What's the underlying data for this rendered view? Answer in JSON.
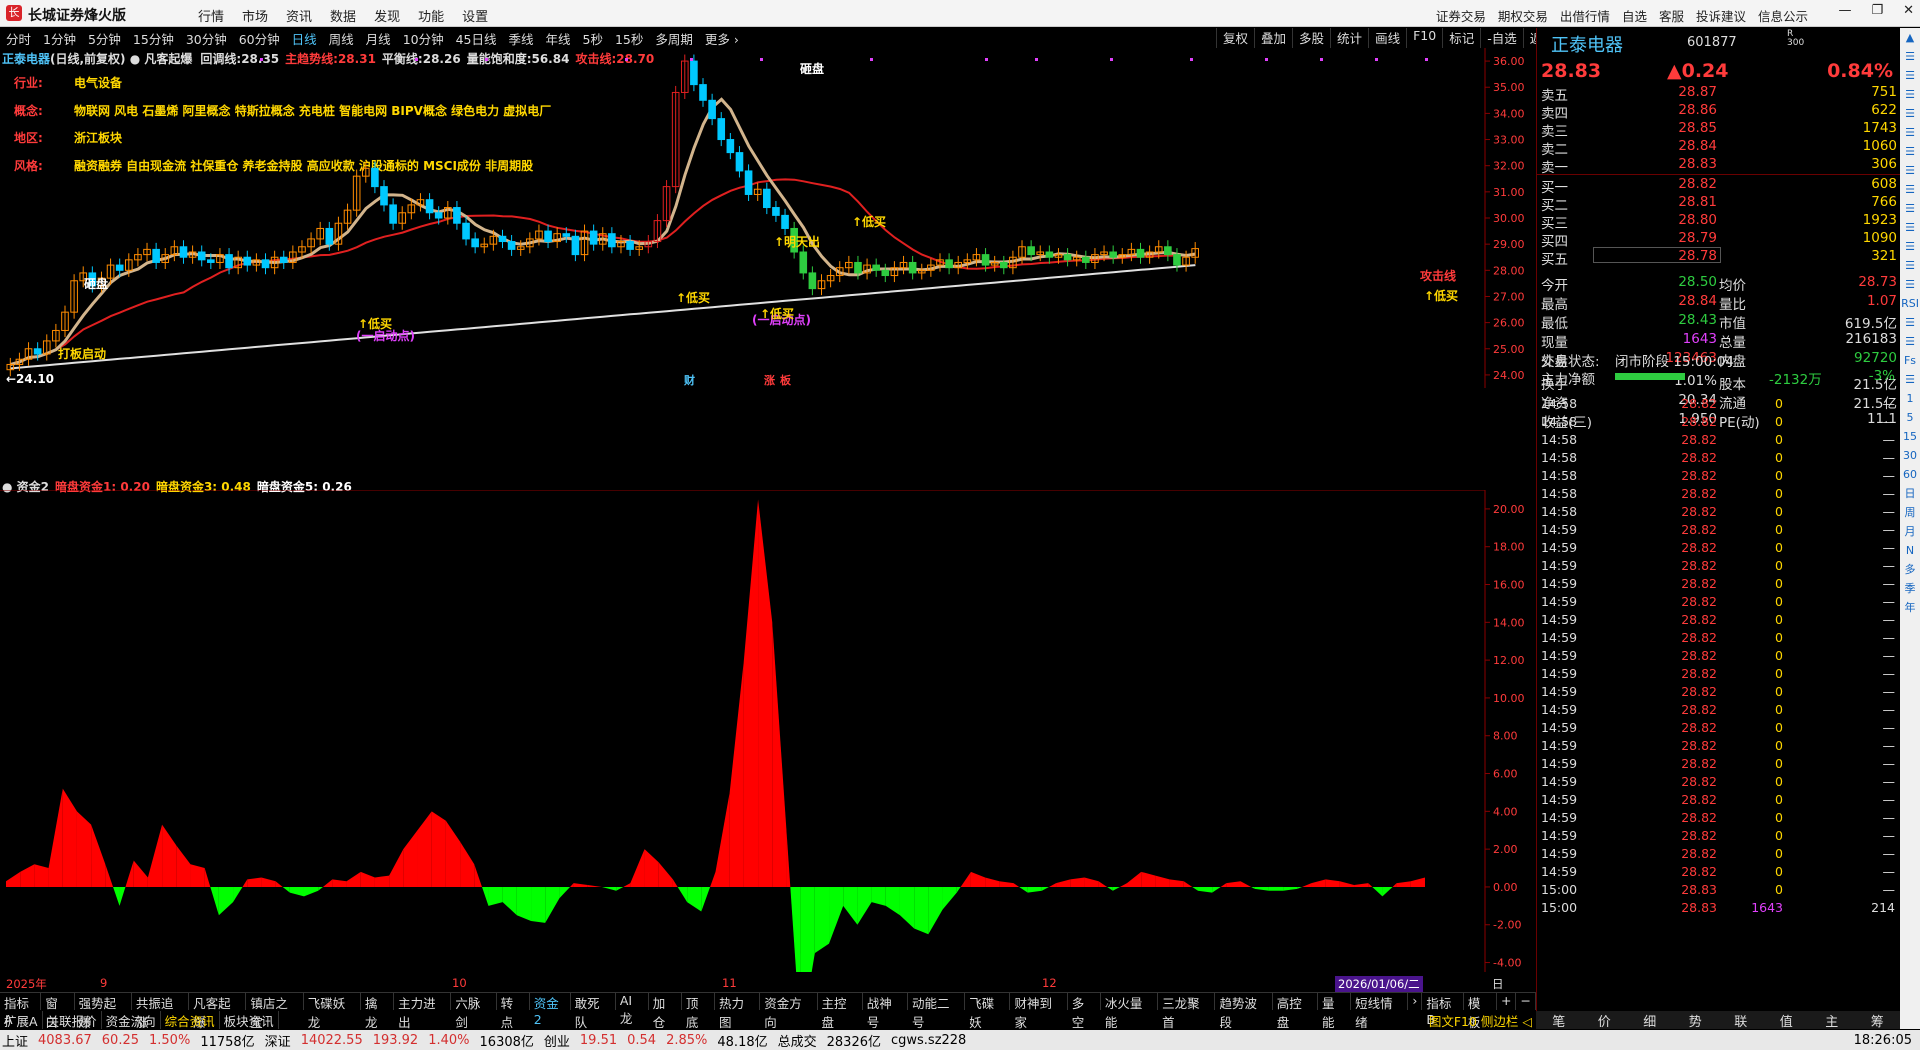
{
  "window": {
    "title": "长城证券烽火版",
    "logo": "长",
    "controls": [
      "—",
      "❐",
      "✕"
    ]
  },
  "menu": [
    "行情",
    "市场",
    "资讯",
    "数据",
    "发现",
    "功能",
    "设置"
  ],
  "right_menu": [
    "证券交易",
    "期权交易",
    "出借行情",
    "自选",
    "客服",
    "投诉建议",
    "信息公示"
  ],
  "periods": [
    "分时",
    "1分钟",
    "5分钟",
    "15分钟",
    "30分钟",
    "60分钟",
    "日线",
    "周线",
    "月线",
    "10分钟",
    "45日线",
    "季线",
    "年线",
    "5秒",
    "15秒",
    "多周期",
    "更多 ›"
  ],
  "active_period": "日线",
  "chart_tools": [
    "复权",
    "叠加",
    "多股",
    "统计",
    "画线",
    "F10",
    "标记",
    "-自选",
    "返回"
  ],
  "kline_header": {
    "name": "正泰电器",
    "mode": "(日线,前复权)",
    "indicator": "凡客起爆",
    "items": [
      {
        "label": "回调线:",
        "value": "28.35",
        "color": "#ddd"
      },
      {
        "label": "主趋势线:",
        "value": "28.31",
        "color": "#ff3b3b"
      },
      {
        "label": "平衡线:",
        "value": "28.26",
        "color": "#ddd"
      },
      {
        "label": "量能饱和度:",
        "value": "56.84",
        "color": "#ddd"
      },
      {
        "label": "攻击线:",
        "value": "28.70",
        "color": "#ff3b3b"
      }
    ]
  },
  "info_panel": [
    {
      "k": "行业:",
      "v": "电气设备"
    },
    {
      "k": "概念:",
      "v": "物联网 风电 石墨烯 阿里概念 特斯拉概念 充电桩 智能电网 BIPV概念 绿色电力 虚拟电厂"
    },
    {
      "k": "地区:",
      "v": "浙江板块"
    },
    {
      "k": "风格:",
      "v": "融资融券 自由现金流 社保重仓 养老金持股 高应收款 沪股通标的 MSCI成份 非周期股"
    }
  ],
  "chart_labels": {
    "low_price": "←24.10",
    "high_word": "砸盘",
    "breakout": "打板启动",
    "low_buy": "↑低买",
    "launch": "(一启动点)",
    "sky_sell": "↑明天出",
    "attack_line": "攻击线",
    "cai": "财",
    "zhang": "涨",
    "ban": "板"
  },
  "price_axis": [
    "36.00",
    "35.00",
    "34.00",
    "33.00",
    "32.00",
    "31.00",
    "30.00",
    "29.00",
    "28.00",
    "27.00",
    "26.00",
    "25.00",
    "24.00"
  ],
  "sub_header": {
    "name": "资金2",
    "items": [
      {
        "label": "暗盘资金1:",
        "value": "0.20",
        "color": "#ff3b3b"
      },
      {
        "label": "暗盘资金3:",
        "value": "0.48",
        "color": "#ffd700"
      },
      {
        "label": "暗盘资金5:",
        "value": "0.26",
        "color": "#fff"
      }
    ]
  },
  "sub_axis": [
    "20.00",
    "18.00",
    "16.00",
    "14.00",
    "12.00",
    "10.00",
    "8.00",
    "6.00",
    "4.00",
    "2.00",
    "0.00",
    "-2.00",
    "-4.00"
  ],
  "time_axis": [
    {
      "t": "2025年",
      "x": 6
    },
    {
      "t": "9",
      "x": 100
    },
    {
      "t": "10",
      "x": 452
    },
    {
      "t": "11",
      "x": 722
    },
    {
      "t": "12",
      "x": 1042
    },
    {
      "t": "2026/01/06/二",
      "x": 1335
    }
  ],
  "time_axis_right": "日线",
  "tabs1": [
    "指标A",
    "窗口",
    "强势起爆",
    "共振追涨",
    "凡客起爆",
    "镇店之宝",
    "飞碟妖龙",
    "擒龙",
    "主力进出",
    "六脉剑",
    "转点",
    "资金2",
    "敢死队",
    "AI龙",
    "加仓",
    "顶底",
    "热力图",
    "资金方向",
    "主控盘",
    "战神号",
    "动能二号",
    "飞碟妖",
    "财神到家",
    "多空",
    "冰火量能",
    "三龙聚首",
    "趋势波段",
    "高控盘",
    "量能",
    "短线情绪",
    "›",
    "指标B",
    "模板",
    "+",
    "−"
  ],
  "active_tab1": "资金2",
  "tabs2": [
    "扩展A",
    "关联报价",
    "资金流向",
    "综合资讯",
    "板块资讯"
  ],
  "tabs2_right": "图文F10 侧边栏 ◁",
  "status": {
    "sh_label": "上证",
    "sh": "4083.67",
    "sh_chg": "60.25",
    "sh_pct": "1.50%",
    "sh_amt": "11758亿",
    "sz_label": "深证",
    "sz": "14022.55",
    "sz_chg": "193.92",
    "sz_pct": "1.40%",
    "sz_amt": "16308亿",
    "cy_label": "创业",
    "cy": "19.51",
    "cy_chg": "0.54",
    "cy_pct": "2.85%",
    "cy_amt": "48.18亿",
    "total_label": "总成交",
    "total": "28326亿",
    "server": "cgws.sz228",
    "time": "18:26:05"
  },
  "quote": {
    "name": "正泰电器",
    "code": "601877",
    "mark_top": "R",
    "mark_bottom": "300",
    "price": "28.83",
    "change": "▲0.24",
    "pct": "0.84%",
    "asks": [
      {
        "l": "卖五",
        "p": "28.87",
        "v": "751"
      },
      {
        "l": "卖四",
        "p": "28.86",
        "v": "622"
      },
      {
        "l": "卖三",
        "p": "28.85",
        "v": "1743"
      },
      {
        "l": "卖二",
        "p": "28.84",
        "v": "1060"
      },
      {
        "l": "卖一",
        "p": "28.83",
        "v": "306"
      }
    ],
    "bids": [
      {
        "l": "买一",
        "p": "28.82",
        "v": "608"
      },
      {
        "l": "买二",
        "p": "28.81",
        "v": "766"
      },
      {
        "l": "买三",
        "p": "28.80",
        "v": "1923"
      },
      {
        "l": "买四",
        "p": "28.79",
        "v": "1090"
      },
      {
        "l": "买五",
        "p": "28.78",
        "v": "321"
      }
    ],
    "stats": [
      {
        "l1": "今开",
        "v1": "28.50",
        "c1": "g",
        "l2": "均价",
        "v2": "28.73",
        "c2": "r"
      },
      {
        "l1": "最高",
        "v1": "28.84",
        "c1": "r",
        "l2": "量比",
        "v2": "1.07",
        "c2": "r"
      },
      {
        "l1": "最低",
        "v1": "28.43",
        "c1": "g",
        "l2": "市值",
        "v2": "619.5亿",
        "c2": "w"
      },
      {
        "l1": "现量",
        "v1": "1643",
        "c1": "m",
        "l2": "总量",
        "v2": "216183",
        "c2": "w"
      },
      {
        "l1": "外盘",
        "v1": "123463",
        "c1": "r",
        "l2": "内盘",
        "v2": "92720",
        "c2": "g"
      },
      {
        "l1": "换手",
        "v1": "1.01%",
        "c1": "w",
        "l2": "股本",
        "v2": "21.5亿",
        "c2": "w"
      },
      {
        "l1": "净资",
        "v1": "20.34",
        "c1": "w",
        "l2": "流通",
        "v2": "21.5亿",
        "c2": "w"
      },
      {
        "l1": "收益(三)",
        "v1": "1.950",
        "c1": "w",
        "l2": "PE(动)",
        "v2": "11.1",
        "c2": "w"
      }
    ],
    "trade_status_label": "交易状态:",
    "trade_status": "闭市阶段 15:00:04",
    "main_net_label": "主力净额",
    "main_net": "-2132万",
    "main_net_pct": "-3%",
    "ticks_count": 30
  },
  "ticks": [
    {
      "t": "14:58",
      "p": "28.82",
      "v": "0"
    },
    {
      "t": "14:58",
      "p": "28.82",
      "v": "0"
    },
    {
      "t": "14:58",
      "p": "28.82",
      "v": "0"
    },
    {
      "t": "14:58",
      "p": "28.82",
      "v": "0"
    },
    {
      "t": "14:58",
      "p": "28.82",
      "v": "0"
    },
    {
      "t": "14:58",
      "p": "28.82",
      "v": "0"
    },
    {
      "t": "14:58",
      "p": "28.82",
      "v": "0"
    },
    {
      "t": "14:59",
      "p": "28.82",
      "v": "0"
    },
    {
      "t": "14:59",
      "p": "28.82",
      "v": "0"
    },
    {
      "t": "14:59",
      "p": "28.82",
      "v": "0"
    },
    {
      "t": "14:59",
      "p": "28.82",
      "v": "0"
    },
    {
      "t": "14:59",
      "p": "28.82",
      "v": "0"
    },
    {
      "t": "14:59",
      "p": "28.82",
      "v": "0"
    },
    {
      "t": "14:59",
      "p": "28.82",
      "v": "0"
    },
    {
      "t": "14:59",
      "p": "28.82",
      "v": "0"
    },
    {
      "t": "14:59",
      "p": "28.82",
      "v": "0"
    },
    {
      "t": "14:59",
      "p": "28.82",
      "v": "0"
    },
    {
      "t": "14:59",
      "p": "28.82",
      "v": "0"
    },
    {
      "t": "14:59",
      "p": "28.82",
      "v": "0"
    },
    {
      "t": "14:59",
      "p": "28.82",
      "v": "0"
    },
    {
      "t": "14:59",
      "p": "28.82",
      "v": "0"
    },
    {
      "t": "14:59",
      "p": "28.82",
      "v": "0"
    },
    {
      "t": "14:59",
      "p": "28.82",
      "v": "0"
    },
    {
      "t": "14:59",
      "p": "28.82",
      "v": "0"
    },
    {
      "t": "14:59",
      "p": "28.82",
      "v": "0"
    },
    {
      "t": "14:59",
      "p": "28.82",
      "v": "0"
    },
    {
      "t": "14:59",
      "p": "28.82",
      "v": "0"
    },
    {
      "t": "15:00",
      "p": "28.83",
      "v": "0"
    },
    {
      "t": "15:00",
      "p": "28.83",
      "v": "1643",
      "extra": "214"
    }
  ],
  "bottom_tabs": [
    "笔",
    "价",
    "细",
    "势",
    "联",
    "值",
    "主",
    "筹"
  ],
  "sidebar": [
    "▲",
    "☰",
    "☰",
    "☰",
    "☰",
    "☰",
    "☰",
    "☰",
    "☰",
    "☰",
    "☰",
    "☰",
    "☰",
    "☰",
    "RSI",
    "☰",
    "☰",
    "Fs",
    "☰",
    "1",
    "5",
    "15",
    "30",
    "60",
    "日",
    "周",
    "月",
    "N",
    "多",
    "季",
    "年"
  ],
  "colors": {
    "up": "#ff3b3b",
    "down": "#2ecc40",
    "accent": "#4fc3f7",
    "ma_main": "#e02020",
    "ma_back": "#d2b48c",
    "ma_long": "#e0e0e0",
    "ma_blue": "#2040ff"
  },
  "chart_data": {
    "type": "candlestick",
    "closes": [
      24.4,
      24.6,
      25.0,
      24.8,
      25.3,
      25.7,
      26.4,
      27.6,
      27.9,
      27.4,
      27.7,
      28.2,
      28.0,
      28.4,
      28.6,
      28.8,
      28.3,
      28.6,
      28.9,
      28.5,
      28.7,
      28.4,
      28.3,
      28.6,
      28.1,
      28.5,
      28.2,
      28.4,
      28.1,
      28.5,
      28.3,
      28.7,
      28.9,
      29.2,
      29.6,
      29.0,
      29.8,
      30.3,
      31.6,
      31.9,
      31.2,
      30.5,
      29.8,
      30.2,
      30.5,
      30.7,
      30.2,
      30.0,
      30.4,
      29.8,
      29.2,
      28.9,
      29.0,
      29.3,
      29.1,
      28.8,
      28.9,
      29.2,
      29.5,
      29.1,
      29.4,
      29.3,
      28.6,
      29.5,
      29.0,
      29.4,
      28.9,
      29.1,
      28.8,
      28.9,
      29.1,
      29.9,
      31.2,
      34.8,
      36.0,
      35.1,
      34.5,
      33.8,
      33.0,
      32.5,
      31.8,
      30.9,
      31.1,
      30.4,
      30.1,
      29.6,
      28.7,
      27.9,
      27.3,
      27.6,
      27.8,
      28.1,
      28.3,
      27.9,
      28.2,
      28.0,
      27.8,
      28.1,
      28.3,
      27.9,
      28.0,
      28.2,
      28.4,
      28.1,
      28.3,
      28.4,
      28.6,
      28.2,
      28.3,
      28.1,
      28.5,
      28.9,
      28.6,
      28.7,
      28.5,
      28.6,
      28.4,
      28.5,
      28.3,
      28.6,
      28.7,
      28.5,
      28.6,
      28.8,
      28.5,
      28.7,
      28.9,
      28.6,
      28.2,
      28.5,
      28.83
    ],
    "volume_flow": [
      0.3,
      0.8,
      1.2,
      1.0,
      5.2,
      4.0,
      3.3,
      1.2,
      -1.0,
      1.4,
      0.5,
      3.3,
      2.2,
      1.2,
      1.0,
      -1.5,
      -0.8,
      0.4,
      0.5,
      0.3,
      -0.3,
      -0.5,
      -0.2,
      0.4,
      0.3,
      0.8,
      0.5,
      0.6,
      2.0,
      3.0,
      4.0,
      3.5,
      2.4,
      1.2,
      -1.0,
      -0.8,
      -1.5,
      -1.8,
      -1.9,
      -0.6,
      0.2,
      0.1,
      0.0,
      -0.2,
      0.2,
      2.0,
      1.3,
      0.4,
      -0.8,
      -1.3,
      0.8,
      5.0,
      12.0,
      20.5,
      14.0,
      3.0,
      -8.0,
      -3.5,
      -3.0,
      -1.0,
      -2.0,
      -0.8,
      -1.0,
      -1.5,
      -2.2,
      -2.5,
      -1.2,
      -0.3,
      0.8,
      0.5,
      0.3,
      0.2,
      -0.3,
      -0.2,
      0.2,
      0.4,
      0.5,
      0.3,
      -0.2,
      0.2,
      0.8,
      0.6,
      0.4,
      0.3,
      -0.2,
      -0.3,
      0.2,
      0.3,
      -0.1,
      -0.2,
      -0.2,
      -0.1,
      0.2,
      0.4,
      0.3,
      0.1,
      0.2,
      -0.5,
      0.2,
      0.3,
      0.5
    ],
    "ylim": [
      23.5,
      36.5
    ],
    "sub_ylim": [
      -4.5,
      21
    ]
  }
}
